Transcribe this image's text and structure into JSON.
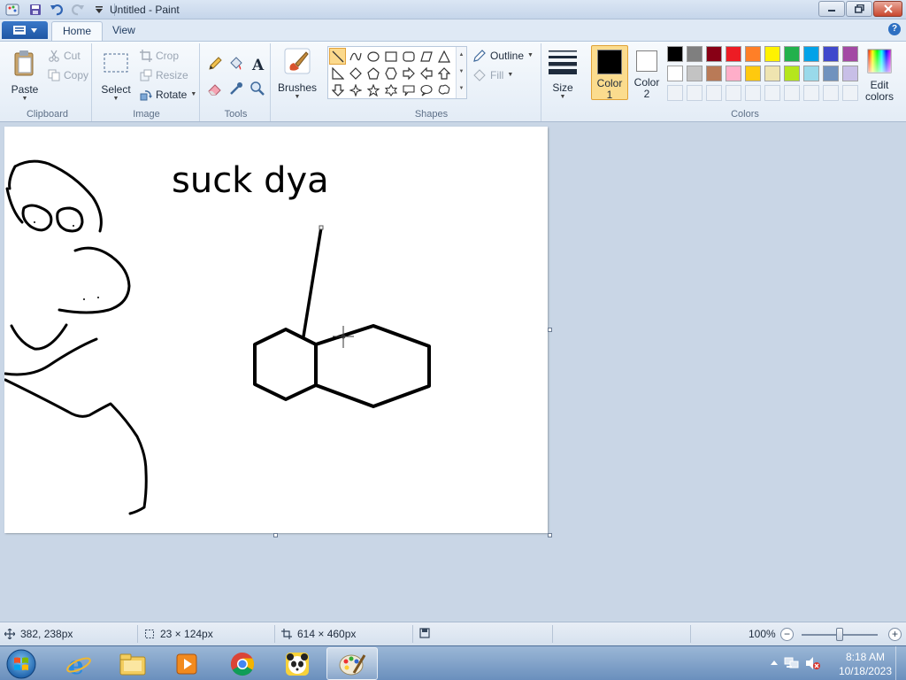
{
  "window": {
    "title": "Untitled - Paint"
  },
  "tabs": [
    {
      "label": "Home"
    },
    {
      "label": "View"
    }
  ],
  "ribbon": {
    "clipboard": {
      "group_label": "Clipboard",
      "paste": "Paste",
      "cut": "Cut",
      "copy": "Copy"
    },
    "image": {
      "group_label": "Image",
      "select": "Select",
      "crop": "Crop",
      "resize": "Resize",
      "rotate": "Rotate"
    },
    "tools": {
      "group_label": "Tools",
      "items": [
        "pencil-icon",
        "fill-bucket-icon",
        "text-icon",
        "eraser-icon",
        "color-picker-icon",
        "magnifier-icon"
      ]
    },
    "brushes": {
      "label": "Brushes"
    },
    "shapes": {
      "group_label": "Shapes",
      "outline": "Outline",
      "fill": "Fill",
      "selected": "line"
    },
    "size": {
      "label": "Size"
    },
    "colors": {
      "group_label": "Colors",
      "color1_label_line1": "Color",
      "color1_label_line2": "1",
      "color2_label_line1": "Color",
      "color2_label_line2": "2",
      "color1": "#000000",
      "color2": "#ffffff",
      "edit_line1": "Edit",
      "edit_line2": "colors",
      "palette_row1": [
        "#000000",
        "#7f7f7f",
        "#880015",
        "#ed1c24",
        "#ff7f27",
        "#fff200",
        "#22b14c",
        "#00a2e8",
        "#3f48cc",
        "#a349a4"
      ],
      "palette_row2": [
        "#ffffff",
        "#c3c3c3",
        "#b97a57",
        "#ffaec9",
        "#ffc90e",
        "#efe4b0",
        "#b5e61d",
        "#99d9ea",
        "#7092be",
        "#c8bfe7"
      ],
      "palette_row3": [
        "#eef2f7",
        "#eef2f7",
        "#eef2f7",
        "#eef2f7",
        "#eef2f7",
        "#eef2f7",
        "#eef2f7",
        "#eef2f7",
        "#eef2f7",
        "#eef2f7"
      ]
    }
  },
  "canvas": {
    "text": "suck dya"
  },
  "statusbar": {
    "cursor_pos": "382, 238px",
    "selection_size": "23 × 124px",
    "image_size": "614 × 460px",
    "zoom": "100%",
    "zoom_level": 1.0
  },
  "taskbar": {
    "apps": [
      "internet-explorer-icon",
      "file-explorer-icon",
      "media-player-icon",
      "chrome-icon",
      "panda-app-icon",
      "paint-icon"
    ],
    "time": "8:18 AM",
    "date": "10/18/2023"
  }
}
